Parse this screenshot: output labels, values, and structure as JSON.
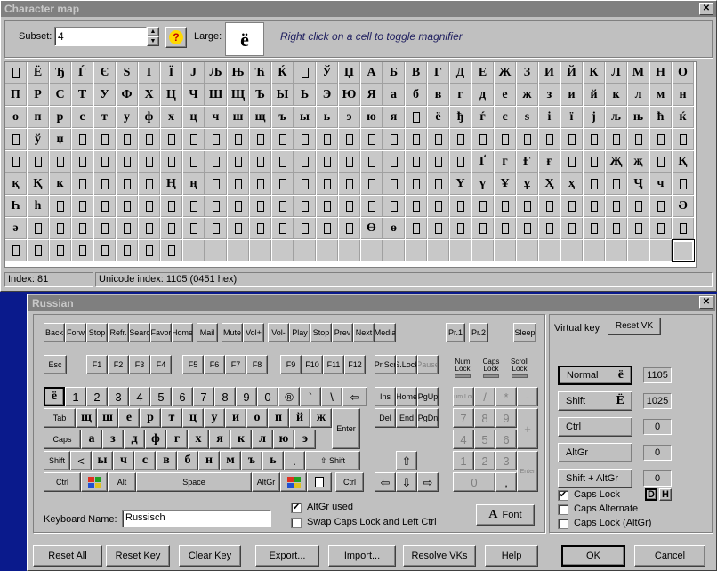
{
  "charmap": {
    "title": "Character map",
    "subset_label": "Subset:",
    "subset_value": "4",
    "large_label": "Large:",
    "large_char": "ё",
    "hint": "Right click on a cell to toggle magnifier",
    "help_icon": "?",
    "rows": [
      [
        "",
        "Ё",
        "Ђ",
        "Ѓ",
        "Є",
        "S",
        "І",
        "Ї",
        "J",
        "Љ",
        "Њ",
        "Ћ",
        "Ќ",
        "",
        "Ў",
        "Џ",
        "А",
        "Б",
        "В",
        "Г",
        "Д",
        "Е",
        "Ж",
        "З",
        "И",
        "Й",
        "К",
        "Л",
        "М",
        "Н",
        "О"
      ],
      [
        "П",
        "Р",
        "С",
        "Т",
        "У",
        "Ф",
        "Х",
        "Ц",
        "Ч",
        "Ш",
        "Щ",
        "Ъ",
        "Ы",
        "Ь",
        "Э",
        "Ю",
        "Я",
        "а",
        "б",
        "в",
        "г",
        "д",
        "е",
        "ж",
        "з",
        "и",
        "й",
        "к",
        "л",
        "м",
        "н"
      ],
      [
        "о",
        "п",
        "р",
        "с",
        "т",
        "у",
        "ф",
        "х",
        "ц",
        "ч",
        "ш",
        "щ",
        "ъ",
        "ы",
        "ь",
        "э",
        "ю",
        "я",
        "",
        "ё",
        "ђ",
        "ѓ",
        "є",
        "s",
        "і",
        "ї",
        "j",
        "љ",
        "њ",
        "ћ",
        "ќ"
      ],
      [
        "",
        "ў",
        "џ",
        "",
        "",
        "",
        "",
        "",
        "",
        "",
        "",
        "",
        "",
        "",
        "",
        "",
        "",
        "",
        "",
        "",
        "",
        "",
        "",
        "",
        "",
        "",
        "",
        "",
        "",
        "",
        ""
      ],
      [
        "",
        "",
        "",
        "",
        "",
        "",
        "",
        "",
        "",
        "",
        "",
        "",
        "",
        "",
        "",
        "",
        "",
        "",
        "",
        "",
        "",
        "Ґ",
        "г",
        "Ғ",
        "ғ",
        "",
        "",
        "Җ",
        "җ",
        "",
        "Қ"
      ],
      [
        "қ",
        "Қ",
        "к",
        "",
        "",
        "",
        "",
        "Ң",
        "ң",
        "",
        "",
        "",
        "",
        "",
        "",
        "",
        "",
        "",
        "",
        "",
        "Ү",
        "ү",
        "Ұ",
        "ұ",
        "Ҳ",
        "ҳ",
        "",
        "",
        "Ҷ",
        "ч",
        ""
      ],
      [
        "Һ",
        "һ",
        "",
        "",
        "",
        "",
        "",
        "",
        "",
        "",
        "",
        "",
        "",
        "",
        "",
        "",
        "",
        "",
        "",
        "",
        "",
        "",
        "",
        "",
        "",
        "",
        "",
        "",
        "",
        "",
        "Ә"
      ],
      [
        "ә",
        "",
        "",
        "",
        "",
        "",
        "",
        "",
        "",
        "",
        "",
        "",
        "",
        "",
        "",
        "",
        "Ө",
        "ө",
        "",
        "",
        "",
        "",
        "",
        "",
        "",
        "",
        "",
        "",
        "",
        "",
        ""
      ],
      [
        "",
        "",
        "",
        "",
        "",
        "",
        "",
        "",
        "",
        "",
        "",
        "",
        "",
        "",
        "",
        "",
        "",
        "",
        "",
        "",
        "",
        "",
        "",
        "",
        "",
        "",
        "",
        "",
        "",
        "",
        ""
      ]
    ],
    "status_index": "Index: 81",
    "status_unicode": "Unicode index: 1105 (0451 hex)"
  },
  "kbd": {
    "title": "Russian",
    "row_fn1": [
      "Back",
      "Forw",
      "Stop",
      "Refr.",
      "Searc",
      "Favor",
      "Home",
      "Mail",
      "Mute",
      "Vol+",
      "Vol-",
      "Play",
      "Stop",
      "Prev",
      "Next",
      "Media",
      "Pr.1",
      "Pr.2",
      "Sleep"
    ],
    "row_fn2": [
      "Esc",
      "F1",
      "F2",
      "F3",
      "F4",
      "F5",
      "F6",
      "F7",
      "F8",
      "F9",
      "F10",
      "F11",
      "F12",
      "Pr.Scr",
      "S.Lock",
      "Pause"
    ],
    "locks": [
      "Num Lock",
      "Caps Lock",
      "Scroll Lock"
    ],
    "row1": [
      "ё",
      "1",
      "2",
      "3",
      "4",
      "5",
      "6",
      "7",
      "8",
      "9",
      "0",
      "®",
      "`",
      "\\",
      "⇦"
    ],
    "row2": [
      "Tab",
      "щ",
      "ш",
      "е",
      "р",
      "т",
      "ц",
      "у",
      "и",
      "о",
      "п",
      "й",
      "ж"
    ],
    "enter": "Enter",
    "row3": [
      "Caps",
      "а",
      "з",
      "д",
      "ф",
      "г",
      "х",
      "я",
      "к",
      "л",
      "ю",
      "э"
    ],
    "row4": [
      "Shift",
      "<",
      "ы",
      "ч",
      "с",
      "в",
      "б",
      "н",
      "м",
      "ъ",
      "ь",
      ".",
      "⇧ Shift"
    ],
    "row5": [
      "Ctrl",
      "Alt",
      "Space",
      "AltGr",
      "Ctrl"
    ],
    "nav": [
      "Ins",
      "Home",
      "PgUp",
      "Del",
      "End",
      "PgDn"
    ],
    "numpad": [
      "Num Lock",
      "/",
      "*",
      "-",
      "7",
      "8",
      "9",
      "+",
      "4",
      "5",
      "6",
      "1",
      "2",
      "3",
      "Enter",
      "0",
      ","
    ],
    "virtual_key_label": "Virtual key",
    "reset_vk": "Reset VK",
    "modes": [
      {
        "label": "Normal",
        "char": "ё",
        "value": "1105"
      },
      {
        "label": "Shift",
        "char": "Ё",
        "value": "1025"
      },
      {
        "label": "Ctrl",
        "char": "",
        "value": "0"
      },
      {
        "label": "AltGr",
        "char": "",
        "value": "0"
      },
      {
        "label": "Shift + AltGr",
        "char": "",
        "value": "0"
      }
    ],
    "caps_lock": "Caps Lock",
    "caps_alternate": "Caps Alternate",
    "caps_lock_altgr": "Caps Lock (AltGr)",
    "d_btn": "D",
    "h_btn": "H",
    "kb_name_label": "Keyboard Name:",
    "kb_name_value": "Russisch",
    "altgr_used": "AltGr used",
    "swap_caps": "Swap Caps Lock and Left Ctrl",
    "font_btn": "Font",
    "font_icon": "A",
    "bottom": [
      "Reset All",
      "Reset Key",
      "Clear Key",
      "Export...",
      "Import...",
      "Resolve VKs",
      "Help",
      "OK",
      "Cancel"
    ]
  }
}
